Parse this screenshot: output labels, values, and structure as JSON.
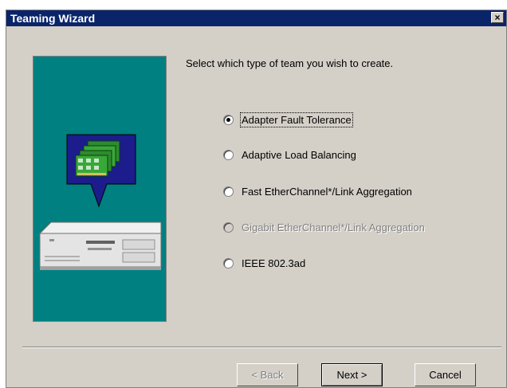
{
  "window": {
    "title": "Teaming Wizard",
    "close_label": "×"
  },
  "prompt": "Select which type of team you wish to create.",
  "options": [
    {
      "label": "Adapter Fault Tolerance",
      "selected": true,
      "enabled": true
    },
    {
      "label": "Adaptive Load Balancing",
      "selected": false,
      "enabled": true
    },
    {
      "label": "Fast EtherChannel*/Link Aggregation",
      "selected": false,
      "enabled": true
    },
    {
      "label": "Gigabit EtherChannel*/Link Aggregation",
      "selected": false,
      "enabled": false
    },
    {
      "label": "IEEE 802.3ad",
      "selected": false,
      "enabled": true
    }
  ],
  "buttons": {
    "back": "< Back",
    "next": "Next >",
    "cancel": "Cancel"
  },
  "colors": {
    "titlebar": "#0a246a",
    "graphic_bg": "#008080",
    "dialog_bg": "#d4d0c8",
    "callout": "#1c1c8c",
    "card": "#2e8b2e"
  },
  "graphic": {
    "description_icon": "network-adapter-cards-server-icon"
  }
}
